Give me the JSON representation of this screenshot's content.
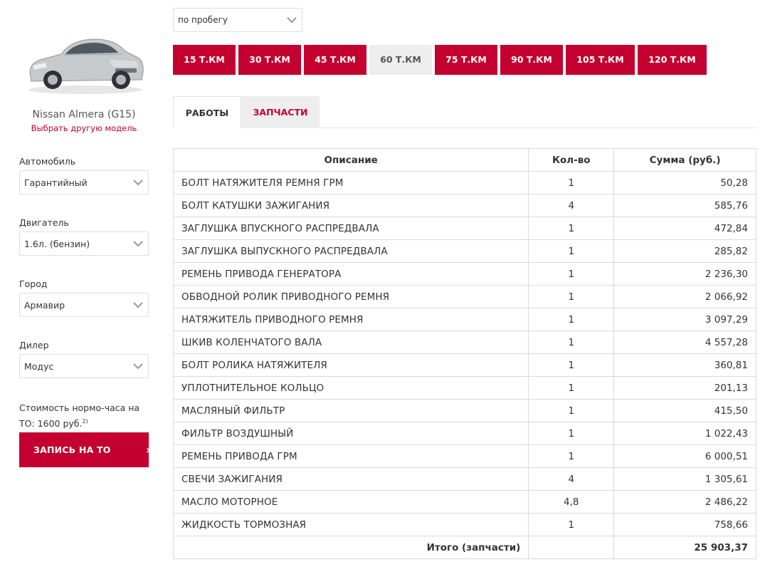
{
  "sidebar": {
    "car": {
      "model": "Nissan Almera (G15)",
      "change_link": "Выбрать другую модель"
    },
    "fields": [
      {
        "label": "Автомобиль",
        "value": "Гарантийный"
      },
      {
        "label": "Двигатель",
        "value": "1.6л. (бензин)"
      },
      {
        "label": "Город",
        "value": "Армавир"
      },
      {
        "label": "Дилер",
        "value": "Модус"
      }
    ],
    "rate": {
      "text": "Стоимость нормо-часа на ТО: 1600 руб.",
      "footnote": "2)"
    },
    "book_button": "ЗАПИСЬ НА ТО",
    "book_arrow": "›"
  },
  "filter": {
    "mileage_select": "по пробегу"
  },
  "intervals": [
    {
      "label": "15 Т.КМ",
      "active": false
    },
    {
      "label": "30 Т.КМ",
      "active": false
    },
    {
      "label": "45 Т.КМ",
      "active": false
    },
    {
      "label": "60 Т.КМ",
      "active": true
    },
    {
      "label": "75 Т.КМ",
      "active": false
    },
    {
      "label": "90 Т.КМ",
      "active": false
    },
    {
      "label": "105 Т.КМ",
      "active": false
    },
    {
      "label": "120 Т.КМ",
      "active": false
    }
  ],
  "tabs": {
    "works": "РАБОТЫ",
    "parts": "ЗАПЧАСТИ",
    "active": "parts"
  },
  "table": {
    "headers": [
      "Описание",
      "Кол-во",
      "Сумма (руб.)"
    ],
    "rows": [
      [
        "БОЛТ НАТЯЖИТЕЛЯ РЕМНЯ ГРМ",
        "1",
        "50,28"
      ],
      [
        "БОЛТ КАТУШКИ ЗАЖИГАНИЯ",
        "4",
        "585,76"
      ],
      [
        "ЗАГЛУШКА ВПУСКНОГО РАСПРЕДВАЛА",
        "1",
        "472,84"
      ],
      [
        "ЗАГЛУШКА ВЫПУСКНОГО РАСПРЕДВАЛА",
        "1",
        "285,82"
      ],
      [
        "РЕМЕНЬ ПРИВОДА ГЕНЕРАТОРА",
        "1",
        "2 236,30"
      ],
      [
        "ОБВОДНОЙ РОЛИК ПРИВОДНОГО РЕМНЯ",
        "1",
        "2 066,92"
      ],
      [
        "НАТЯЖИТЕЛЬ ПРИВОДНОГО РЕМНЯ",
        "1",
        "3 097,29"
      ],
      [
        "ШКИВ КОЛЕНЧАТОГО ВАЛА",
        "1",
        "4 557,28"
      ],
      [
        "БОЛТ РОЛИКА НАТЯЖИТЕЛЯ",
        "1",
        "360,81"
      ],
      [
        "УПЛОТНИТЕЛЬНОЕ КОЛЬЦО",
        "1",
        "201,13"
      ],
      [
        "МАСЛЯНЫЙ ФИЛЬТР",
        "1",
        "415,50"
      ],
      [
        "ФИЛЬТР ВОЗДУШНЫЙ",
        "1",
        "1 022,43"
      ],
      [
        "РЕМЕНЬ ПРИВОДА ГРМ",
        "1",
        "6 000,51"
      ],
      [
        "СВЕЧИ ЗАЖИГАНИЯ",
        "4",
        "1 305,61"
      ],
      [
        "МАСЛО МОТОРНОЕ",
        "4,8",
        "2 486,22"
      ],
      [
        "ЖИДКОСТЬ ТОРМОЗНАЯ",
        "1",
        "758,66"
      ]
    ],
    "total_label": "Итого (запчасти)",
    "total_value": "25 903,37"
  },
  "colors": {
    "accent": "#c3002f",
    "inactive_bg": "#eeeeee"
  }
}
